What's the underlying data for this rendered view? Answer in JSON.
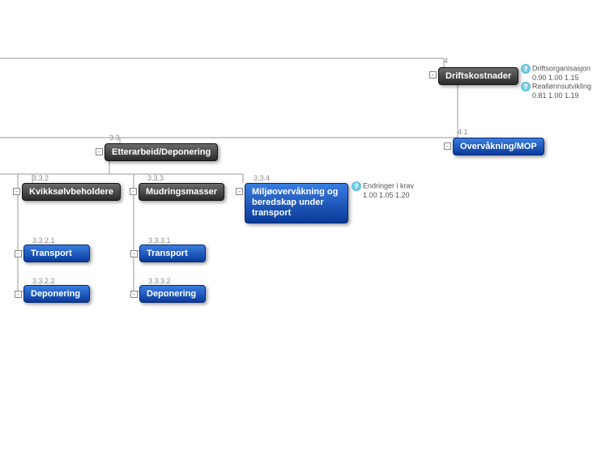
{
  "nodes": {
    "n4": {
      "idx": "4",
      "label": "Driftskostnader"
    },
    "n41": {
      "idx": "4.1",
      "label": "Overvåkning/MOP"
    },
    "n33": {
      "idx": "3.3",
      "label": "Etterarbeid/Deponering"
    },
    "n332": {
      "idx": "3.3.2",
      "label": "Kvikksølvbeholdere"
    },
    "n333": {
      "idx": "3.3.3",
      "label": "Mudringsmasser"
    },
    "n334": {
      "idx": "3.3.4",
      "label": "Miljøovervåkning og beredskap under transport"
    },
    "n3321": {
      "idx": "3.3.2.1",
      "label": "Transport"
    },
    "n3322": {
      "idx": "3.3.2.2",
      "label": "Deponering"
    },
    "n3331": {
      "idx": "3.3.3.1",
      "label": "Transport"
    },
    "n3332": {
      "idx": "3.3.3.2",
      "label": "Deponering"
    }
  },
  "annotations": {
    "drift1": {
      "label": "Driftsorganisasjon",
      "vals": "0.90    1.00    1.15"
    },
    "drift2": {
      "label": "Reallønnsutvikling",
      "vals": "0.81    1.00    1.19"
    },
    "endr": {
      "label": "Endringer i krav",
      "vals": "1.00    1.05    1.20"
    }
  },
  "toggle": {
    "minus": "-"
  }
}
